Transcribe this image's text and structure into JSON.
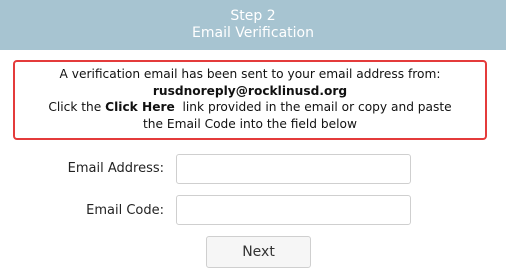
{
  "header": {
    "step": "Step 2",
    "title": "Email Verification"
  },
  "notice": {
    "line1": "A verification email has been sent to your email address from:",
    "sender": "rusdnoreply@rocklinusd.org",
    "line3_prefix": "Click the ",
    "line3_link": "Click Here",
    "line3_suffix": "  link provided in the email or copy and paste",
    "line4": "the Email Code into the field below"
  },
  "form": {
    "email_label": "Email Address:",
    "email_value": "",
    "code_label": "Email Code:",
    "code_value": "",
    "next_label": "Next"
  },
  "colors": {
    "header_bg": "#a7c4d1",
    "notice_border": "#e43b3b"
  }
}
